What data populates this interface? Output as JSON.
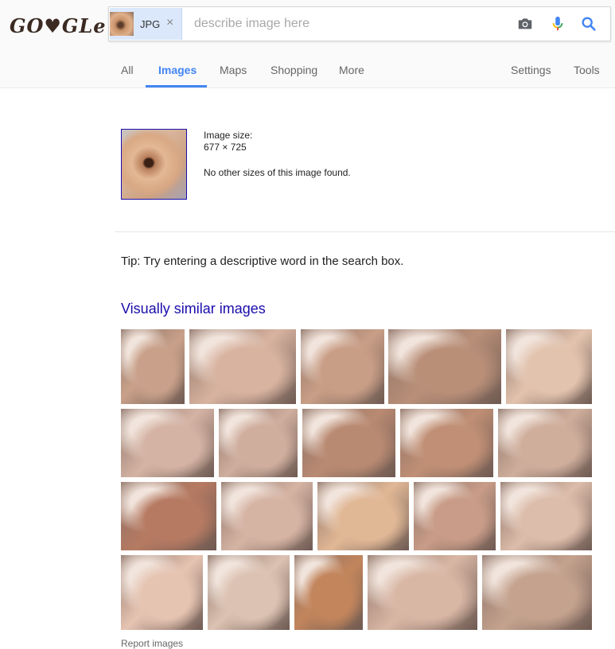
{
  "logo": "GO♥GLe",
  "search": {
    "chip_label": "JPG",
    "chip_close": "×",
    "placeholder": "describe image here"
  },
  "tabs": {
    "all": "All",
    "images": "Images",
    "maps": "Maps",
    "shopping": "Shopping",
    "more": "More",
    "settings": "Settings",
    "tools": "Tools"
  },
  "result": {
    "size_label": "Image size:",
    "size_value": "677 × 725",
    "no_sizes": "No other sizes of this image found."
  },
  "tip": "Tip: Try entering a descriptive word in the search box.",
  "similar_title": "Visually similar images",
  "similar_images": [
    {
      "tone": "#c9a18a"
    },
    {
      "tone": "#d8b3a0"
    },
    {
      "tone": "#c99e86"
    },
    {
      "tone": "#b98f78"
    },
    {
      "tone": "#e2c3ae"
    },
    {
      "tone": "#d4b3a4"
    },
    {
      "tone": "#cfae9e"
    },
    {
      "tone": "#b98a72"
    },
    {
      "tone": "#c08f75"
    },
    {
      "tone": "#cfae9c"
    },
    {
      "tone": "#b67a62"
    },
    {
      "tone": "#d6b4a4"
    },
    {
      "tone": "#e1b896"
    },
    {
      "tone": "#c89c88"
    },
    {
      "tone": "#dcbcaa"
    },
    {
      "tone": "#e6c4b2"
    },
    {
      "tone": "#dcc2b2"
    },
    {
      "tone": "#c2855c"
    },
    {
      "tone": "#d9b7a5"
    },
    {
      "tone": "#c4a28e"
    }
  ],
  "report": "Report images",
  "colors": {
    "accent": "#4285f4",
    "link": "#1a0dab",
    "mic_blue": "#4285f4",
    "mic_red": "#ea4335",
    "mic_yellow": "#fbbc05",
    "mic_green": "#34a853"
  }
}
